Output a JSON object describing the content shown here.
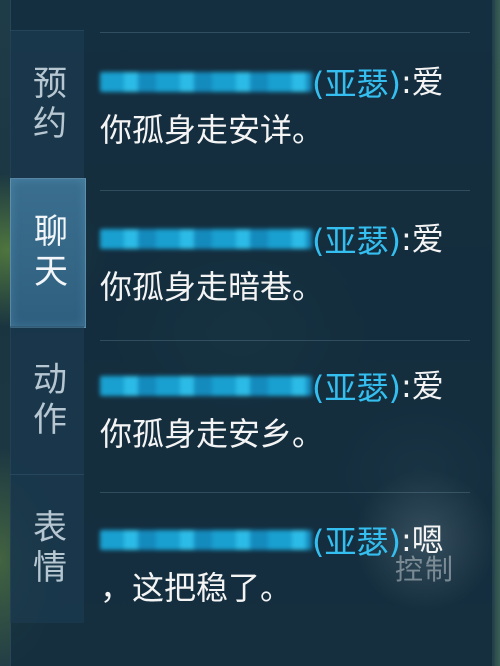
{
  "tabs": [
    {
      "label": "预约",
      "active": false
    },
    {
      "label": "聊天",
      "active": true
    },
    {
      "label": "动作",
      "active": false
    },
    {
      "label": "表情",
      "active": false
    }
  ],
  "messages": [
    {
      "hero": "(亚瑟)",
      "colon": ":",
      "text_line1": "爱",
      "text_line2": "你孤身走安详。"
    },
    {
      "hero": "(亚瑟)",
      "colon": ":",
      "text_line1": "爱",
      "text_line2": "你孤身走暗巷。"
    },
    {
      "hero": "(亚瑟)",
      "colon": ":",
      "text_line1": "爱",
      "text_line2": "你孤身走安乡。"
    },
    {
      "hero": "(亚瑟)",
      "colon": ":",
      "text_line1": "嗯",
      "text_line2": "，这把稳了。"
    }
  ],
  "control": {
    "label": "控制"
  },
  "colors": {
    "hero_name": "#34bff0",
    "message_text": "#f4f4f4",
    "active_tab": "#3b6f8f",
    "blurred_name": "#1aa6d8"
  }
}
